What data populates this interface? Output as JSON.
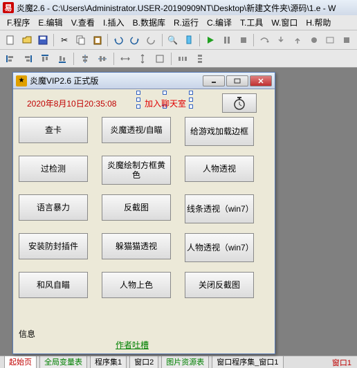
{
  "main": {
    "title": "炎魔2.6 - C:\\Users\\Administrator.USER-20190909NT\\Desktop\\新建文件夹\\源码\\1.e - W",
    "app_icon_text": "易"
  },
  "menus": [
    "F.程序",
    "E.编辑",
    "V.查看",
    "I.插入",
    "B.数据库",
    "R.运行",
    "C.编译",
    "T.工具",
    "W.窗口",
    "H.帮助"
  ],
  "child": {
    "title": "炎魔VIP2.6 正式版",
    "icon_text": "★"
  },
  "panel": {
    "timestamp": "2020年8月10日20:35:08",
    "join_chat": "加入聊天室",
    "buttons": [
      [
        "查卡",
        "炎魔透视/自瞄",
        "给游戏加载边框"
      ],
      [
        "过检测",
        "炎魔绘制方框黄色",
        "人物透视"
      ],
      [
        "语言暴力",
        "反截图",
        "线条透视（win7）"
      ],
      [
        "安装防封插件",
        "躲猫猫透视",
        "人物透视（win7）"
      ],
      [
        "和风自瞄",
        "人物上色",
        "关闭反截图"
      ]
    ],
    "info_label": "信息",
    "author_link": "作者吐槽"
  },
  "tabs": {
    "items": [
      "起始页",
      "全局变量表",
      "程序集1",
      "窗口2",
      "图片资源表",
      "窗口程序集_窗口1"
    ],
    "trail": "窗口1"
  }
}
